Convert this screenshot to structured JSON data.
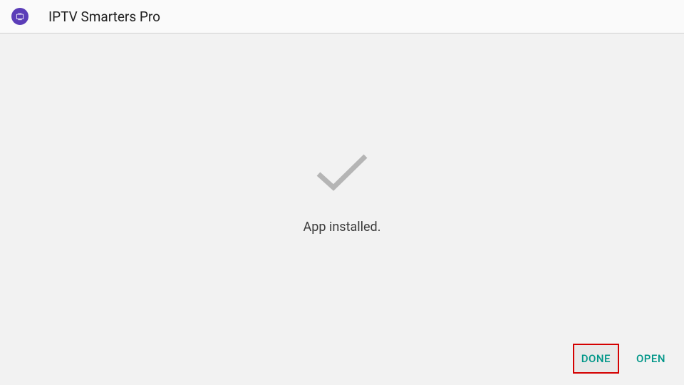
{
  "header": {
    "app_title": "IPTV Smarters Pro",
    "icon_name": "tv-icon"
  },
  "main": {
    "status_message": "App installed."
  },
  "actions": {
    "done_label": "DONE",
    "open_label": "OPEN"
  },
  "colors": {
    "accent": "#009688",
    "highlight_border": "#d40000",
    "icon_bg": "#5b3db8"
  }
}
